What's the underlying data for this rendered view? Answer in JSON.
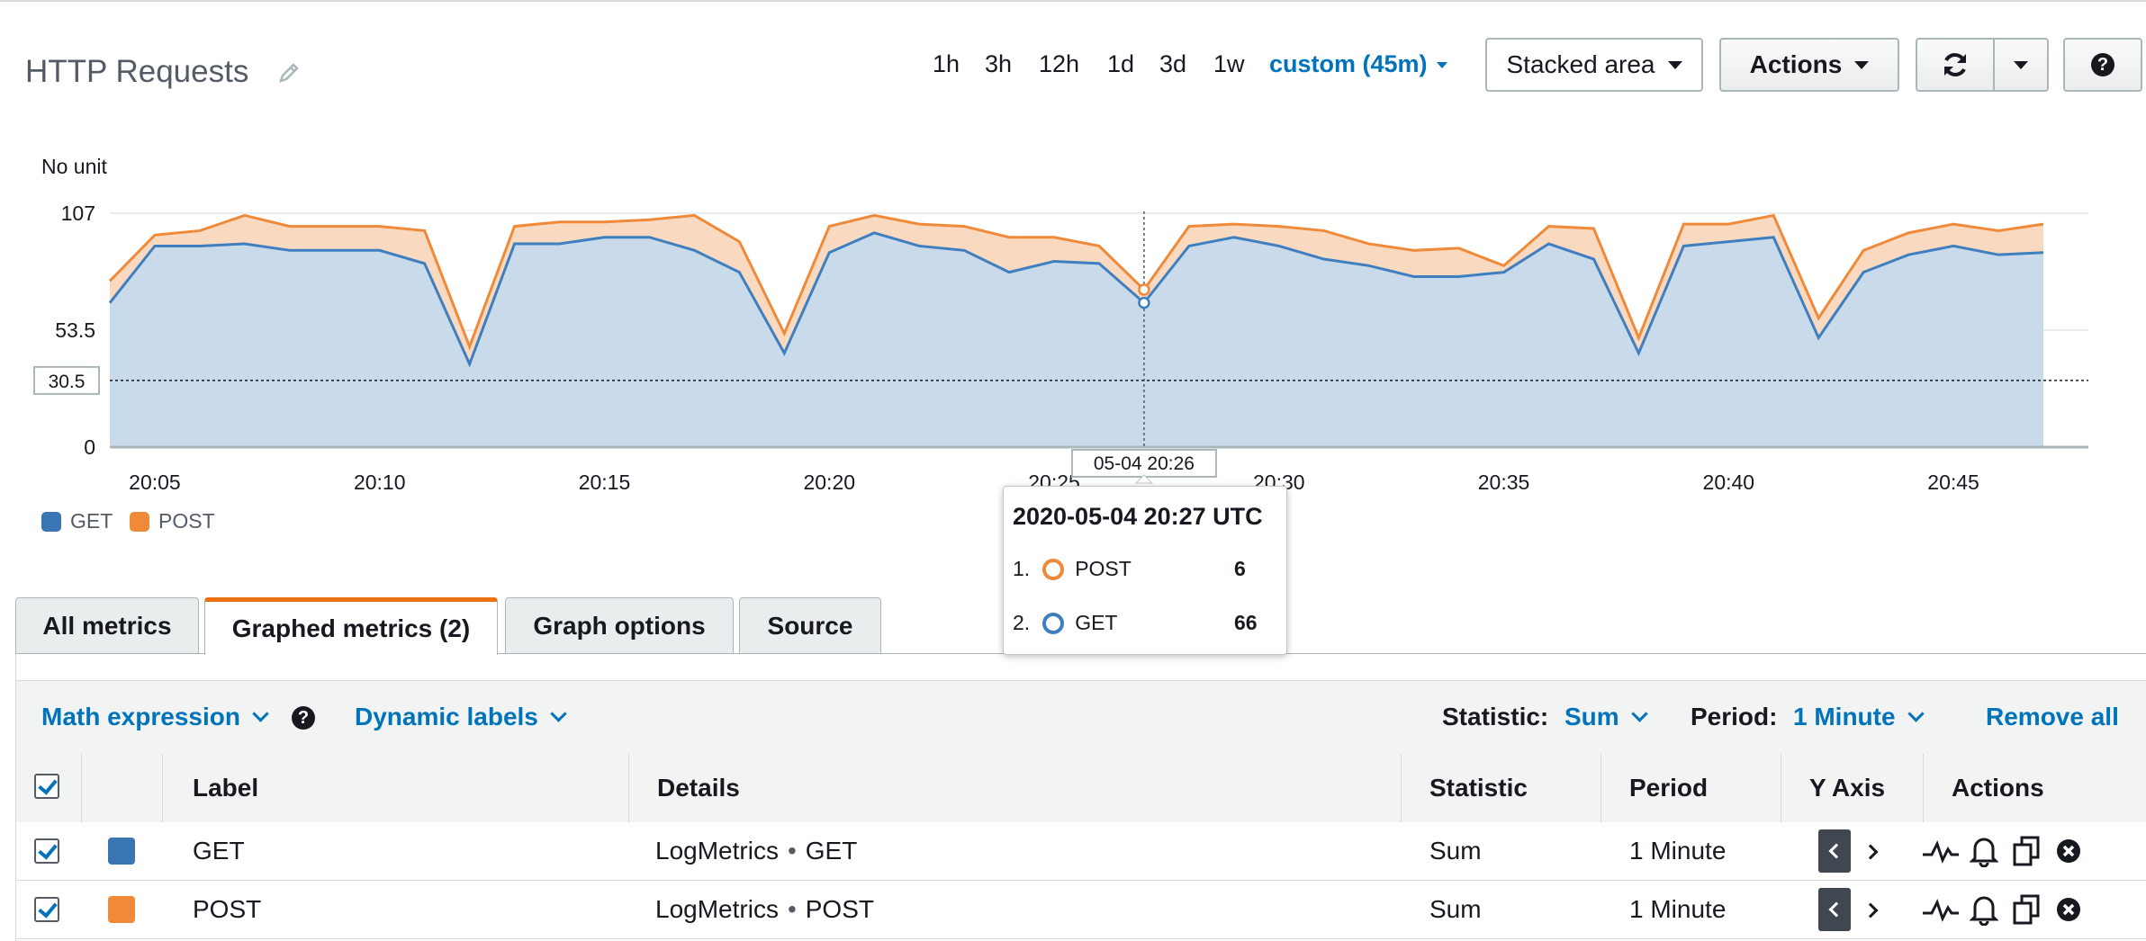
{
  "header": {
    "title": "HTTP Requests",
    "ranges": [
      "1h",
      "3h",
      "12h",
      "1d",
      "3d",
      "1w"
    ],
    "custom_range": "custom (45m)",
    "view_select": "Stacked area",
    "actions_label": "Actions",
    "help_label": "?"
  },
  "chart_data": {
    "type": "area",
    "stacked": true,
    "unit_label": "No unit",
    "x": [
      "20:04",
      "20:05",
      "20:06",
      "20:07",
      "20:08",
      "20:09",
      "20:10",
      "20:11",
      "20:12",
      "20:13",
      "20:14",
      "20:15",
      "20:16",
      "20:17",
      "20:18",
      "20:19",
      "20:20",
      "20:21",
      "20:22",
      "20:23",
      "20:24",
      "20:25",
      "20:26",
      "20:27",
      "20:28",
      "20:29",
      "20:30",
      "20:31",
      "20:32",
      "20:33",
      "20:34",
      "20:35",
      "20:36",
      "20:37",
      "20:38",
      "20:39",
      "20:40",
      "20:41",
      "20:42",
      "20:43",
      "20:44",
      "20:45",
      "20:46",
      "20:47"
    ],
    "x_ticks": [
      "20:05",
      "20:10",
      "20:15",
      "20:20",
      "20:25",
      "20:30",
      "20:35",
      "20:40",
      "20:45"
    ],
    "series": [
      {
        "name": "GET",
        "color": "#3f7fbf",
        "fill": "#c9dbeb",
        "values": [
          66,
          92,
          92,
          93,
          90,
          90,
          90,
          84,
          38,
          93,
          93,
          96,
          96,
          90,
          80,
          43,
          89,
          98,
          92,
          90,
          80,
          85,
          84,
          66,
          92,
          96,
          92,
          86,
          83,
          78,
          78,
          80,
          93,
          86,
          43,
          92,
          94,
          96,
          50,
          80,
          88,
          92,
          88,
          89
        ]
      },
      {
        "name": "POST",
        "color": "#ef8a3b",
        "fill": "#f9d9c0",
        "values": [
          10,
          5,
          7,
          13,
          11,
          11,
          11,
          15,
          8,
          8,
          10,
          7,
          8,
          16,
          14,
          9,
          12,
          8,
          10,
          11,
          16,
          11,
          8,
          6,
          9,
          6,
          9,
          13,
          10,
          12,
          13,
          3,
          8,
          14,
          7,
          10,
          8,
          10,
          9,
          10,
          10,
          10,
          11,
          13
        ]
      }
    ],
    "y_ticks": [
      "0",
      "53.5",
      "107"
    ],
    "ylim": [
      0,
      107
    ],
    "threshold_label": "30.5",
    "threshold": 30.5,
    "crosshair_label": "05-04 20:26",
    "crosshair_index": 23,
    "legend": "bottom-left"
  },
  "tooltip": {
    "title": "2020-05-04 20:27 UTC",
    "rows": [
      {
        "rank": "1.",
        "name": "POST",
        "value": "6",
        "color": "#ef8a3b"
      },
      {
        "rank": "2.",
        "name": "GET",
        "value": "66",
        "color": "#3f7fbf"
      }
    ]
  },
  "tabs": [
    "All metrics",
    "Graphed metrics (2)",
    "Graph options",
    "Source"
  ],
  "toolbar": {
    "math_expression": "Math expression",
    "dynamic_labels": "Dynamic labels",
    "statistic_label": "Statistic:",
    "statistic_value": "Sum",
    "period_label": "Period:",
    "period_value": "1 Minute",
    "remove_all": "Remove all"
  },
  "table": {
    "headers": [
      "Label",
      "Details",
      "Statistic",
      "Period",
      "Y Axis",
      "Actions"
    ],
    "rows": [
      {
        "color": "#3a75b4",
        "label": "GET",
        "namespace": "LogMetrics",
        "metric": "GET",
        "statistic": "Sum",
        "period": "1 Minute"
      },
      {
        "color": "#f08a38",
        "label": "POST",
        "namespace": "LogMetrics",
        "metric": "POST",
        "statistic": "Sum",
        "period": "1 Minute"
      }
    ]
  }
}
